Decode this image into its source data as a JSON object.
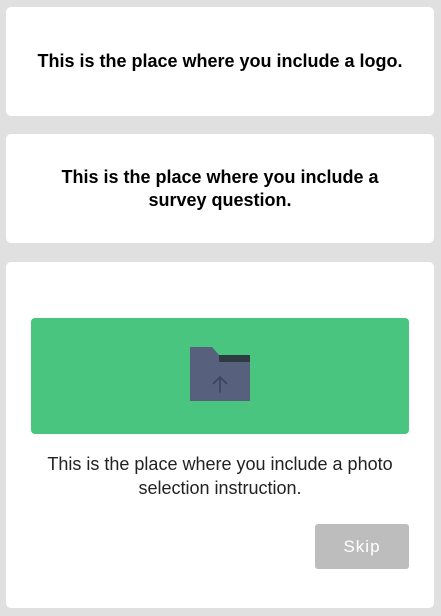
{
  "logo_card": {
    "text": "This is the place where you include a logo."
  },
  "question_card": {
    "text": "This is the place where you include a survey question."
  },
  "photo_card": {
    "upload_icon": "folder-upload-icon",
    "instruction": "This is the place where you include a photo selection instruction.",
    "skip_label": "Skip"
  },
  "colors": {
    "background": "#e0e0e0",
    "card": "#ffffff",
    "upload_area": "#4ac580",
    "folder": "#57607c",
    "skip_button": "#bdbdbd"
  }
}
